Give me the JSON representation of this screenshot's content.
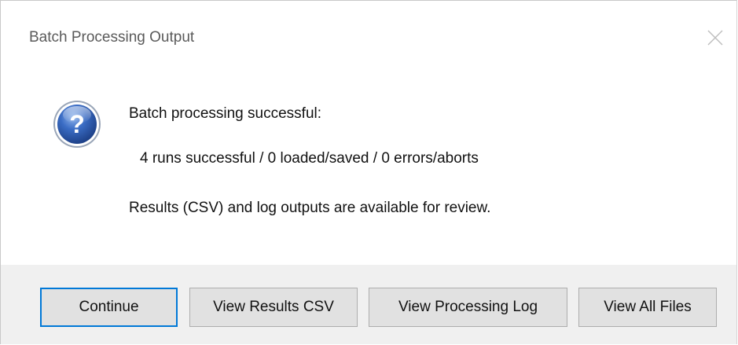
{
  "window": {
    "title": "Batch Processing Output"
  },
  "icons": {
    "close": "close-icon",
    "question": "question-icon"
  },
  "message": {
    "line1": "Batch processing successful:",
    "line2": "4 runs successful / 0 loaded/saved / 0 errors/aborts",
    "line3": "Results (CSV) and log outputs are available for review."
  },
  "buttons": {
    "continue": "Continue",
    "view_csv": "View Results CSV",
    "view_log": "View Processing Log",
    "view_all": "View All Files"
  },
  "colors": {
    "footer_bg": "#f0f0f0",
    "button_bg": "#e1e1e1",
    "default_focus": "#0078d7",
    "icon_blue": "#2f5fb3"
  }
}
